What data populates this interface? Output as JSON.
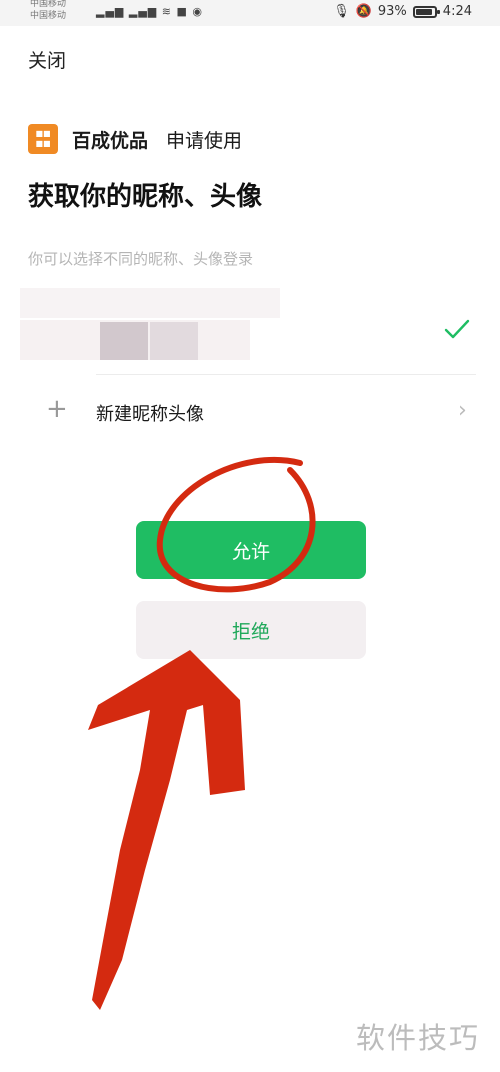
{
  "status_bar": {
    "carrier_1": "中国移动",
    "carrier_2": "中国移动",
    "battery_percent": "93%",
    "time": "4:24"
  },
  "header": {
    "close_label": "关闭"
  },
  "app": {
    "name": "百成优品",
    "request_text": "申请使用",
    "logo_color": "#f08a24"
  },
  "page": {
    "title": "获取你的昵称、头像",
    "subtitle": "你可以选择不同的昵称、头像登录"
  },
  "profile_option": {
    "selected": true,
    "check_icon": "check-icon"
  },
  "new_profile": {
    "label": "新建昵称头像",
    "icon": "plus-icon"
  },
  "buttons": {
    "allow_label": "允许",
    "deny_label": "拒绝",
    "allow_color": "#1fbd63"
  },
  "annotation": {
    "circle_color": "#d42a10",
    "arrow_color": "#d42a10"
  },
  "watermark": "软件技巧"
}
